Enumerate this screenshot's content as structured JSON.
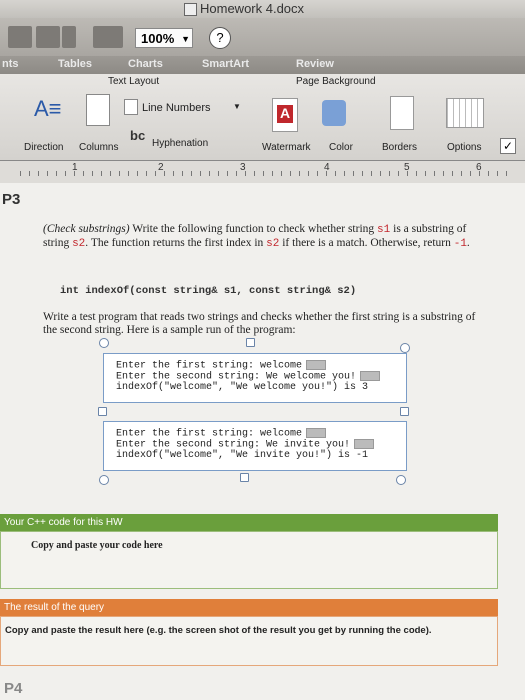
{
  "window": {
    "title": "Homework 4.docx"
  },
  "toolbar": {
    "zoom": "100%",
    "help": "?"
  },
  "tabs": [
    {
      "label": "nts"
    },
    {
      "label": "Tables"
    },
    {
      "label": "Charts"
    },
    {
      "label": "SmartArt"
    },
    {
      "label": "Review"
    }
  ],
  "ribbon": {
    "text_layout_title": "Text Layout",
    "page_background_title": "Page Background",
    "line_numbers": "Line Numbers",
    "direction": "Direction",
    "columns": "Columns",
    "hyphenation": "Hyphenation",
    "watermark": "Watermark",
    "color": "Color",
    "borders": "Borders",
    "options": "Options"
  },
  "ruler": {
    "marks": [
      "1",
      "2",
      "3",
      "4",
      "5",
      "6"
    ]
  },
  "document": {
    "p3_label": "P3",
    "problem_intro": "(Check substrings)",
    "problem_text_1": " Write the following function to check whether string ",
    "s1": "s1",
    "problem_text_2": " is a substring of string ",
    "s2": "s2",
    "problem_text_3": ". The function returns the first index in ",
    "s2b": "s2",
    "problem_text_4": " if there is a match. Otherwise, return ",
    "minus_one": "-1",
    "problem_text_5": ".",
    "signature": "int indexOf(const string& s1, const string& s2)",
    "test_text": "Write a test program that reads two strings and checks whether the first string is a substring of the second string. Here is a sample run of the program:",
    "run1": [
      "Enter the first string: welcome",
      "Enter the second string: We welcome you!",
      "indexOf(\"welcome\", \"We welcome you!\") is 3"
    ],
    "run2": [
      "Enter the first string: welcome",
      "Enter the second string: We invite you!",
      "indexOf(\"welcome\", \"We invite you!\") is -1"
    ],
    "code_section_title": "Your C++ code for this HW",
    "code_section_body": "Copy and paste your code here",
    "result_section_title": "The result of the query",
    "result_section_body": "Copy and paste the result here (e.g. the screen shot of the result you get by running the code).",
    "p4_label": "P4"
  },
  "colors": {
    "code_red": "#c2272d",
    "green_header": "#6a9f3c",
    "orange_header": "#e07f3a",
    "selection_blue": "#7a9cc7"
  }
}
